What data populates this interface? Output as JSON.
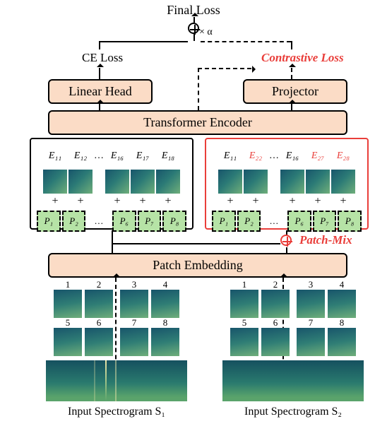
{
  "top": {
    "final_loss": "Final Loss",
    "xalpha": "× α",
    "ce_loss": "CE Loss",
    "contrastive_loss": "Contrastive Loss"
  },
  "blocks": {
    "linear_head": "Linear Head",
    "projector": "Projector",
    "encoder": "Transformer Encoder",
    "patch_embedding": "Patch Embedding"
  },
  "ops": {
    "patch_mix": "Patch-Mix"
  },
  "seq_left": {
    "E": [
      "E₁₁",
      "E₁₂",
      "…",
      "E₁₆",
      "E₁₇",
      "E₁₈"
    ],
    "P": [
      "P₁",
      "P₂",
      "…",
      "P₆",
      "P₇",
      "P₈"
    ]
  },
  "seq_right": {
    "E": [
      "E₁₁",
      "E₂₂",
      "…",
      "E₁₆",
      "E₂₇",
      "E₂₈"
    ],
    "E_red": [
      false,
      true,
      false,
      false,
      true,
      true
    ],
    "P": [
      "P₁",
      "P₂",
      "…",
      "P₆",
      "P₇",
      "P₈"
    ]
  },
  "patches": {
    "nums": [
      "1",
      "2",
      "3",
      "4",
      "5",
      "6",
      "7",
      "8"
    ]
  },
  "captions": {
    "s1": "Input Spectrogram S₁",
    "s2": "Input Spectrogram S₂"
  }
}
